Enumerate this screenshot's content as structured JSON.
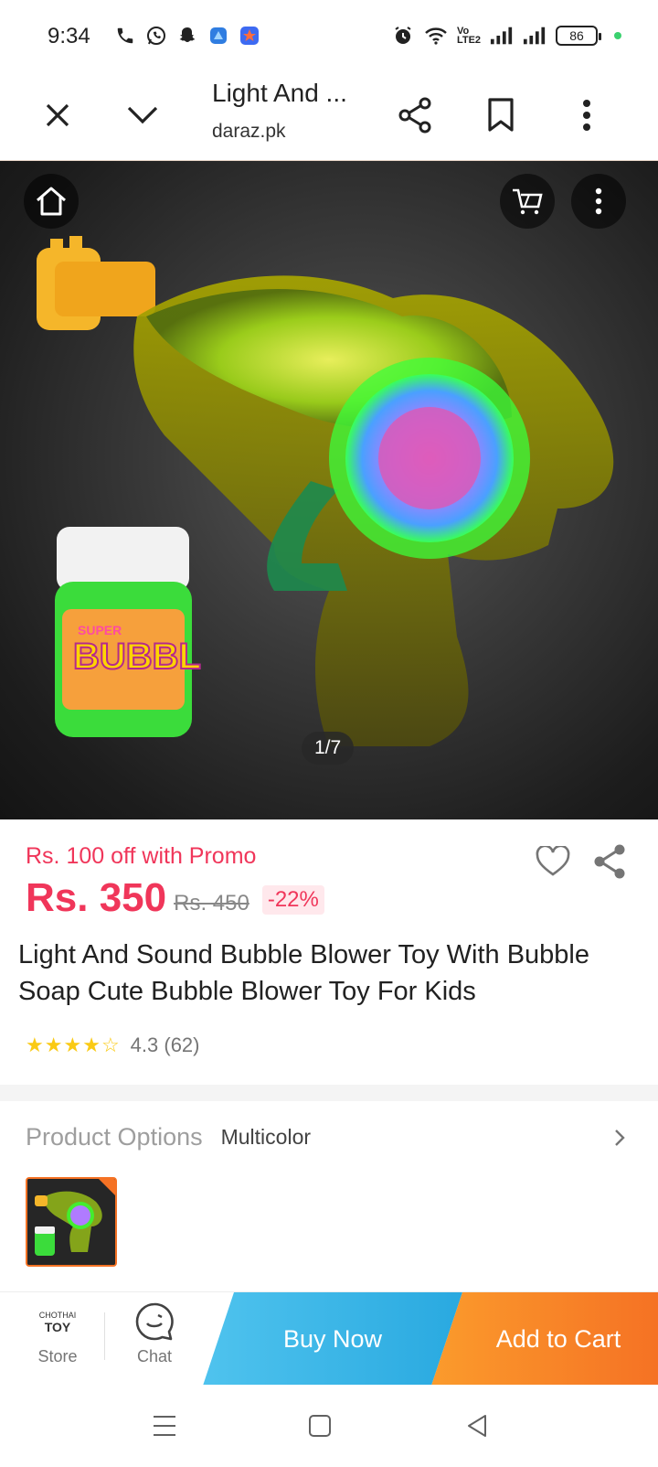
{
  "status_bar": {
    "time": "9:34",
    "battery": "86",
    "left_icons": [
      "phone-icon",
      "whatsapp-icon",
      "snapchat-icon",
      "app-icon",
      "app-star-icon"
    ],
    "right_icons": [
      "alarm-icon",
      "wifi-icon",
      "volte-icon",
      "signal-icon",
      "signal-icon"
    ]
  },
  "tab_bar": {
    "title": "Light And ...",
    "domain": "daraz.pk"
  },
  "hero": {
    "page_indicator": "1/7"
  },
  "product": {
    "promo": "Rs. 100 off with Promo",
    "price": "Rs. 350",
    "original_price": "Rs. 450",
    "discount": "-22%",
    "title": "Light And Sound Bubble Blower Toy With Bubble Soap Cute Bubble Blower Toy For Kids",
    "rating": 4.3,
    "rating_text": "4.3 (62)",
    "star_color": "#faca15"
  },
  "options": {
    "label": "Product Options",
    "value": "Multicolor"
  },
  "action_bar": {
    "store_logo_top": "CHOTHAI",
    "store_logo_main": "TOY",
    "store_label": "Store",
    "chat_label": "Chat",
    "buy_now": "Buy Now",
    "add_to_cart": "Add to Cart"
  },
  "colors": {
    "accent": "#f0365a",
    "buy_now": "#29a9e0",
    "add_to_cart": "#f57224"
  }
}
